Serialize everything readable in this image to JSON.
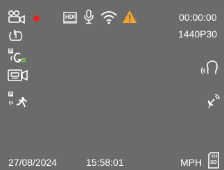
{
  "status_bar": {
    "rec_time": "00:00:00",
    "resolution": "1440P30",
    "hdr_label": "HDR",
    "recording_dot_color": "#e8231f",
    "warning_color": "#f5a623"
  },
  "footer": {
    "date": "27/08/2024",
    "time": "15:58:01",
    "speed_unit": "MPH",
    "sd_label": "SD"
  },
  "icons": [
    "dual-camera-icon",
    "recording-indicator",
    "hdr-icon",
    "microphone-icon",
    "wifi-icon",
    "warning-icon",
    "loop-recording-icon",
    "parking-gsensor-icon",
    "driver-camera-icon",
    "parking-motion-icon",
    "voice-control-icon",
    "gps-satellite-icon",
    "sd-card-icon"
  ]
}
